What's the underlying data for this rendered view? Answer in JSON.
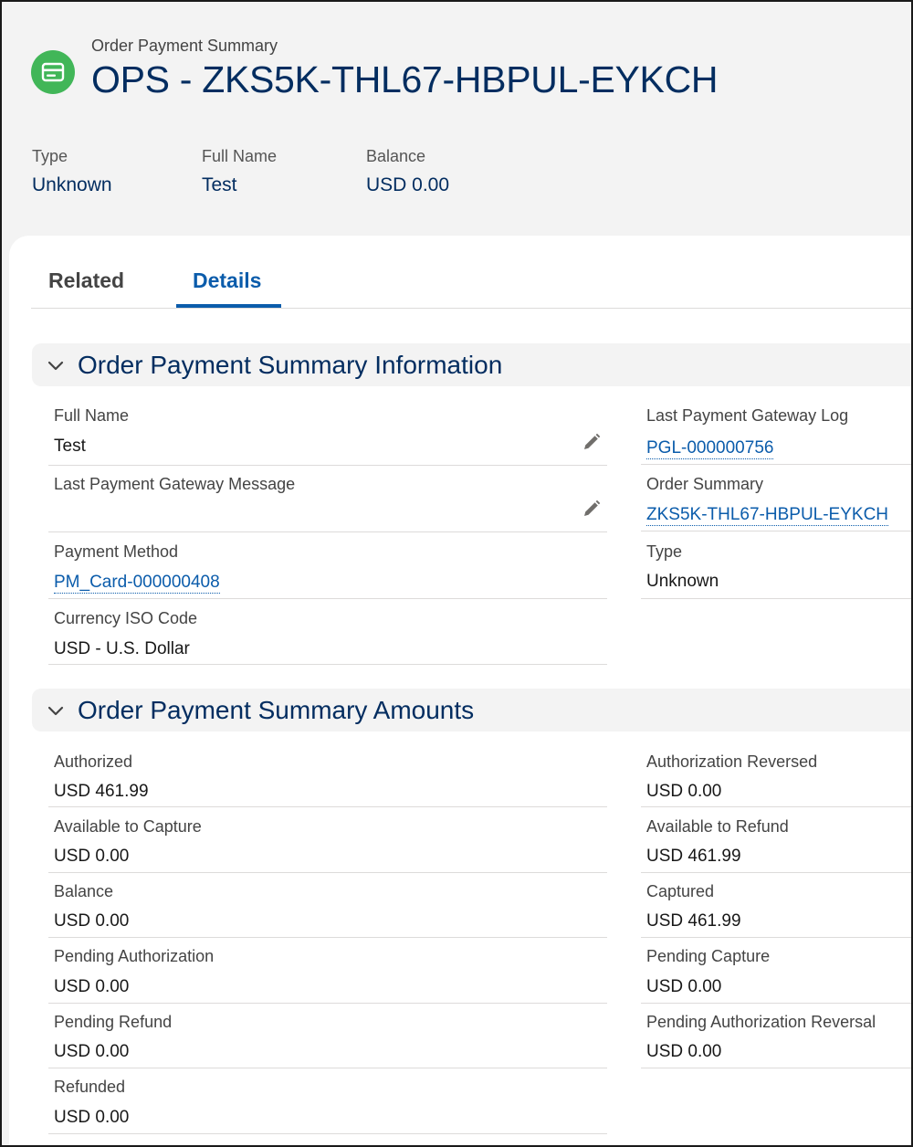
{
  "header": {
    "object_type": "Order Payment Summary",
    "title": "OPS - ZKS5K-THL67-HBPUL-EYKCH",
    "icon": "credit-card-icon",
    "icon_color": "#41b658",
    "highlights": [
      {
        "label": "Type",
        "value": "Unknown"
      },
      {
        "label": "Full Name",
        "value": "Test"
      },
      {
        "label": "Balance",
        "value": "USD 0.00"
      }
    ]
  },
  "tabs": [
    {
      "label": "Related",
      "active": false
    },
    {
      "label": "Details",
      "active": true
    }
  ],
  "sections": [
    {
      "title": "Order Payment Summary Information",
      "left": [
        {
          "label": "Full Name",
          "value": "Test",
          "editable": true
        },
        {
          "label": "Last Payment Gateway Message",
          "value": "",
          "editable": true
        },
        {
          "label": "Payment Method",
          "value": "PM_Card-000000408",
          "link": true
        },
        {
          "label": "Currency ISO Code",
          "value": "USD - U.S. Dollar"
        }
      ],
      "right": [
        {
          "label": "Last Payment Gateway Log",
          "value": "PGL-000000756",
          "link": true
        },
        {
          "label": "Order Summary",
          "value": "ZKS5K-THL67-HBPUL-EYKCH",
          "link": true
        },
        {
          "label": "Type",
          "value": "Unknown"
        }
      ]
    },
    {
      "title": "Order Payment Summary Amounts",
      "left": [
        {
          "label": "Authorized",
          "value": "USD 461.99"
        },
        {
          "label": "Available to Capture",
          "value": "USD 0.00"
        },
        {
          "label": "Balance",
          "value": "USD 0.00"
        },
        {
          "label": "Pending Authorization",
          "value": "USD 0.00"
        },
        {
          "label": "Pending Refund",
          "value": "USD 0.00"
        },
        {
          "label": "Refunded",
          "value": "USD 0.00"
        }
      ],
      "right": [
        {
          "label": "Authorization Reversed",
          "value": "USD 0.00"
        },
        {
          "label": "Available to Refund",
          "value": "USD 461.99"
        },
        {
          "label": "Captured",
          "value": "USD 461.99"
        },
        {
          "label": "Pending Capture",
          "value": "USD 0.00"
        },
        {
          "label": "Pending Authorization Reversal",
          "value": "USD 0.00"
        }
      ]
    }
  ],
  "colors": {
    "brand_navy": "#032d60",
    "link_blue": "#0b5cab"
  }
}
